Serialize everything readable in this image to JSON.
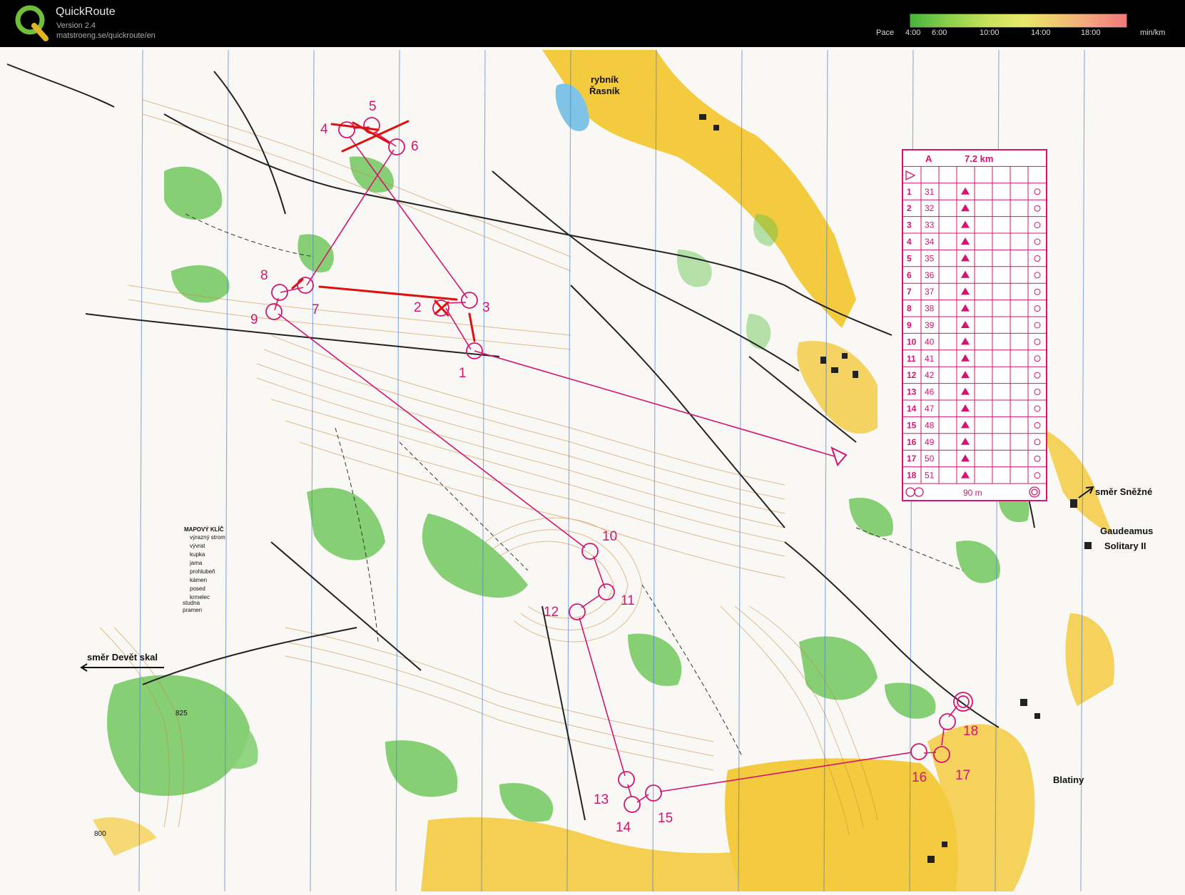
{
  "header": {
    "app_title": "QuickRoute",
    "version": "Version 2.4",
    "url": "matstroeng.se/quickroute/en",
    "pace_label": "Pace",
    "pace_ticks": [
      "4:00",
      "6:00",
      "10:00",
      "14:00",
      "18:00"
    ],
    "pace_unit": "min/km",
    "pace_gradient_colors": [
      "#46b43c",
      "#8dd04a",
      "#c8e05a",
      "#e8e86a",
      "#f0c870",
      "#f4a080",
      "#f07a7a"
    ]
  },
  "map": {
    "place_labels": {
      "lake": [
        "rybník",
        "Řasník"
      ],
      "direction_snezne": "směr Sněžné",
      "gaudeamus": "Gaudeamus",
      "solitary": "Solitary II",
      "blatiny": "Blatiny",
      "direction_devet": "směr Devět skal",
      "height_825": "825",
      "height_800": "800"
    },
    "legend": {
      "title": "MAPOVÝ KLÍČ",
      "items": [
        "výrazný strom",
        "vývrat",
        "kupka",
        "jama",
        "prohlubeň",
        "kámen",
        "posed",
        "krmelec",
        "studna",
        "pramen"
      ]
    },
    "control_numbers": [
      "1",
      "2",
      "3",
      "4",
      "5",
      "6",
      "7",
      "8",
      "9",
      "10",
      "11",
      "12",
      "13",
      "14",
      "15",
      "16",
      "17",
      "18"
    ],
    "course_color": "#d4146e",
    "route_color": "#e01010"
  },
  "control_card": {
    "course": "A",
    "length": "7.2 km",
    "rows": [
      {
        "n": "1",
        "code": "31"
      },
      {
        "n": "2",
        "code": "32"
      },
      {
        "n": "3",
        "code": "33"
      },
      {
        "n": "4",
        "code": "34"
      },
      {
        "n": "5",
        "code": "35"
      },
      {
        "n": "6",
        "code": "36"
      },
      {
        "n": "7",
        "code": "37"
      },
      {
        "n": "8",
        "code": "38"
      },
      {
        "n": "9",
        "code": "39"
      },
      {
        "n": "10",
        "code": "40"
      },
      {
        "n": "11",
        "code": "41"
      },
      {
        "n": "12",
        "code": "42"
      },
      {
        "n": "13",
        "code": "46"
      },
      {
        "n": "14",
        "code": "47"
      },
      {
        "n": "15",
        "code": "48"
      },
      {
        "n": "16",
        "code": "49"
      },
      {
        "n": "17",
        "code": "50"
      },
      {
        "n": "18",
        "code": "51"
      }
    ],
    "finish_distance": "90 m"
  }
}
